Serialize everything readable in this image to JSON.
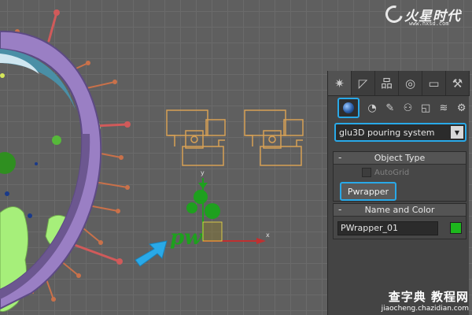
{
  "app": {
    "logo": {
      "text": "火星时代",
      "url": "www.hxsd.com"
    },
    "watermark": {
      "title": "查字典 教程网",
      "url": "jiaocheng.chazidian.com"
    }
  },
  "viewport": {
    "axis": {
      "x": "x",
      "y": "y"
    },
    "gizmo_label": "pw"
  },
  "command_panel": {
    "tabs": [
      {
        "icon": "create-icon",
        "glyph": "✷",
        "active": true
      },
      {
        "icon": "modify-icon",
        "glyph": "◸",
        "active": false
      },
      {
        "icon": "hierarchy-icon",
        "glyph": "品",
        "active": false
      },
      {
        "icon": "motion-icon",
        "glyph": "◎",
        "active": false
      },
      {
        "icon": "display-icon",
        "glyph": "▭",
        "active": false
      },
      {
        "icon": "utilities-icon",
        "glyph": "⚒",
        "active": false
      }
    ],
    "create_buttons": [
      {
        "icon": "geometry-icon",
        "glyph": "",
        "active": true
      },
      {
        "icon": "shapes-icon",
        "glyph": "◔"
      },
      {
        "icon": "lights-icon",
        "glyph": "✎"
      },
      {
        "icon": "cameras-icon",
        "glyph": "⚇"
      },
      {
        "icon": "helpers-icon",
        "glyph": "◱"
      },
      {
        "icon": "space-warps-icon",
        "glyph": "≋"
      },
      {
        "icon": "systems-icon",
        "glyph": "⚙"
      }
    ],
    "category_dropdown": {
      "value": "glu3D pouring system"
    },
    "object_type": {
      "title": "Object Type",
      "collapse": "-",
      "autogrid_label": "AutoGrid",
      "button_label": "Pwrapper"
    },
    "name_color": {
      "title": "Name and Color",
      "collapse": "-",
      "name_value": "PWrapper_01",
      "color": "#1db81d"
    }
  },
  "colors": {
    "accent": "#29a9e8",
    "ring": "#9a7fc4",
    "spike": "#d05a5a",
    "fluid": "#a6ef7a",
    "helper_orange": "#d7a055",
    "gizmo_green": "#1ea01e"
  }
}
